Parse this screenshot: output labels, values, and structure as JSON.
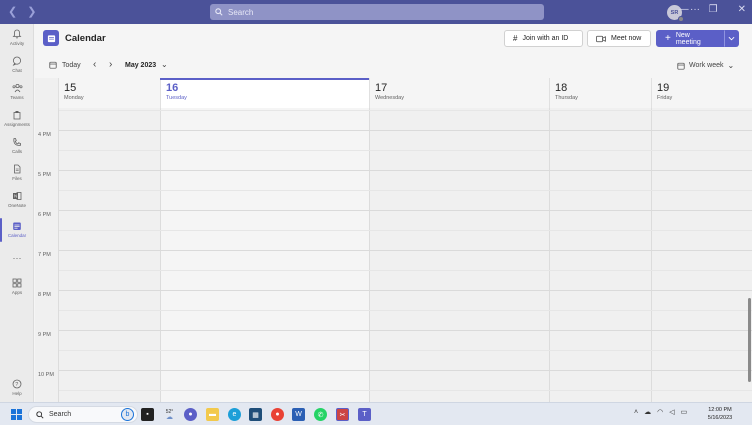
{
  "titlebar": {
    "search_placeholder": "Search",
    "avatar_initials": "SR",
    "more_label": "···",
    "window_controls": [
      "—",
      "❐",
      "✕"
    ]
  },
  "rail": [
    {
      "label": "Activity",
      "icon": "bell-icon"
    },
    {
      "label": "Chat",
      "icon": "chat-icon"
    },
    {
      "label": "Teams",
      "icon": "teams-icon"
    },
    {
      "label": "Assignments",
      "icon": "assignments-icon"
    },
    {
      "label": "Calls",
      "icon": "phone-icon"
    },
    {
      "label": "Files",
      "icon": "file-icon"
    },
    {
      "label": "OneNote",
      "icon": "onenote-icon"
    },
    {
      "label": "Calendar",
      "icon": "calendar-icon",
      "active": true
    },
    {
      "label": "···",
      "icon": "more-icon"
    },
    {
      "label": "Apps",
      "icon": "apps-icon"
    },
    {
      "label": "Help",
      "icon": "help-icon"
    }
  ],
  "header": {
    "title": "Calendar",
    "join_label": "Join with an ID",
    "meet_label": "Meet now",
    "new_meeting_label": "New meeting"
  },
  "toolbar": {
    "today_label": "Today",
    "month_label": "May 2023",
    "view_label": "Work week"
  },
  "days": [
    {
      "num": "15",
      "name": "Monday"
    },
    {
      "num": "16",
      "name": "Tuesday",
      "today": true
    },
    {
      "num": "17",
      "name": "Wednesday"
    },
    {
      "num": "18",
      "name": "Thursday"
    },
    {
      "num": "19",
      "name": "Friday"
    }
  ],
  "times": [
    "4 PM",
    "5 PM",
    "6 PM",
    "7 PM",
    "8 PM",
    "9 PM",
    "10 PM"
  ],
  "taskbar": {
    "search_label": "Search",
    "weather_temp": "52°",
    "clock_time": "12:00 PM",
    "clock_date": "5/16/2023"
  },
  "colors": {
    "accent": "#5b5fc7",
    "titlebar": "#4b5299"
  }
}
